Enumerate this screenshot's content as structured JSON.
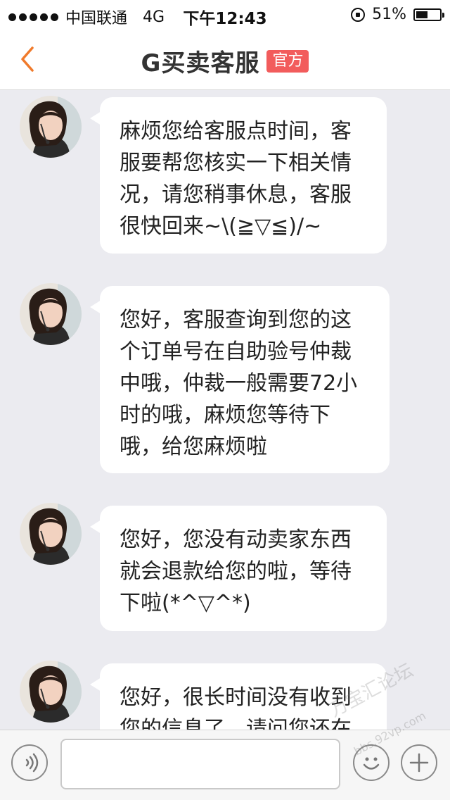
{
  "status_bar": {
    "carrier": "中国联通",
    "network": "4G",
    "time": "下午12:43",
    "battery_percent_label": "51%",
    "battery_level": 0.51
  },
  "nav": {
    "title": "G买卖客服",
    "badge": "官方",
    "accent_color": "#f07a2b",
    "badge_color": "#f25c5c"
  },
  "messages": [
    {
      "lines": [
        "麻烦您给客服点时间，客",
        "服要帮您核实一下相关情",
        "况，请您稍事休息，客服",
        "很快回来~\\(≧▽≦)/~"
      ]
    },
    {
      "lines": [
        "您好，客服查询到您的这",
        "个订单号在自助验号仲裁",
        "中哦，仲裁一般需要72小",
        "时的哦，麻烦您等待下",
        "哦，给您麻烦啦"
      ]
    },
    {
      "lines": [
        "您好，您没有动卖家东西",
        "就会退款给您的啦，等待",
        "下啦(*^▽^*)"
      ]
    },
    {
      "lines": [
        "您好，很长时间没有收到",
        "您的信息了，请问您还在"
      ]
    }
  ],
  "input_bar": {
    "placeholder": "",
    "value": ""
  },
  "watermark": {
    "text": "万宝汇论坛",
    "url": "bbs.92vp.com"
  },
  "icons": {
    "back": "chevron-left-icon",
    "voice": "voice-icon",
    "emoji": "emoji-icon",
    "plus": "plus-icon"
  }
}
